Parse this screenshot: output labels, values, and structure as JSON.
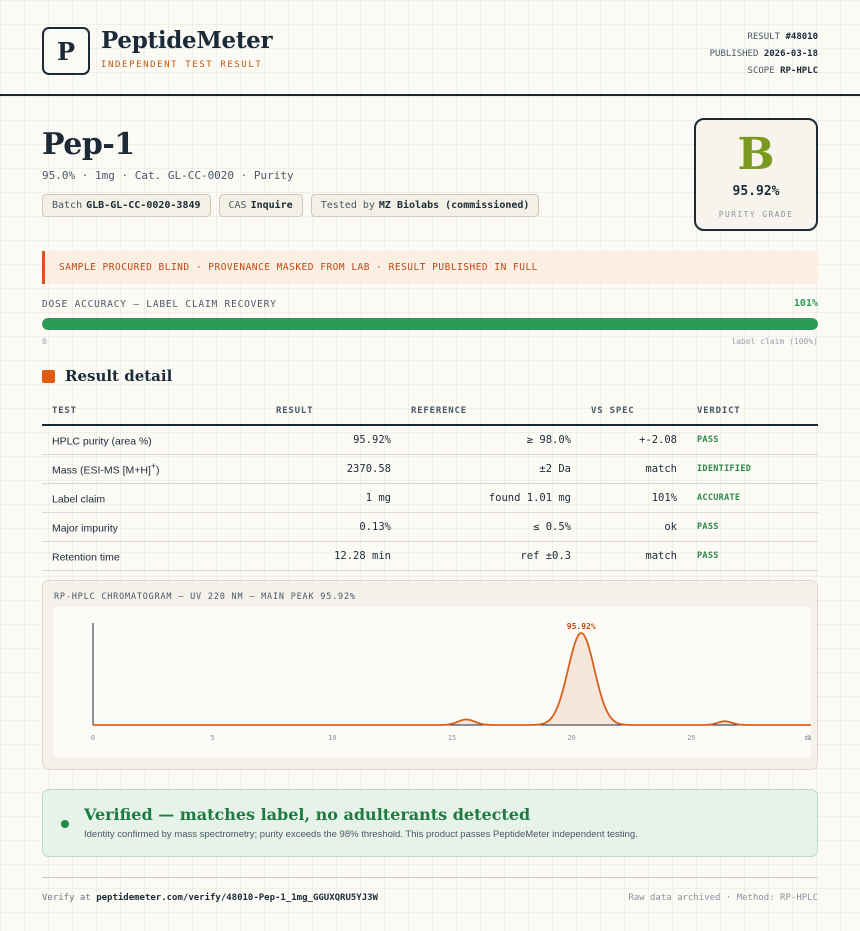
{
  "header": {
    "logo_letter": "P",
    "brand": "PeptideMeter",
    "tagline": "INDEPENDENT TEST RESULT",
    "result_label": "RESULT",
    "result_id": "#48010",
    "published_label": "PUBLISHED",
    "published_date": "2026-03-18",
    "scope_label": "SCOPE",
    "scope_value": "RP-HPLC"
  },
  "product": {
    "name": "Pep-1",
    "specs": "95.0% · 1mg · Cat. GL-CC-0020 · Purity",
    "chips": [
      {
        "label": "Batch",
        "value": "GLB-GL-CC-0020-3849"
      },
      {
        "label": "CAS",
        "value": "Inquire"
      },
      {
        "label": "Tested by",
        "value": "MZ Biolabs (commissioned)"
      }
    ]
  },
  "grade": {
    "letter": "B",
    "value": "95.92%",
    "label": "PURITY GRADE",
    "color": "#7a9a1f"
  },
  "banner": {
    "text": "SAMPLE PROCURED BLIND · PROVENANCE MASKED FROM LAB · RESULT PUBLISHED IN FULL"
  },
  "dose": {
    "label": "DOSE ACCURACY — LABEL CLAIM RECOVERY",
    "value_text": "101%",
    "fill_fraction": 1.0,
    "min_label": "0",
    "max_label": "label claim (100%)",
    "color": "#2e9a57"
  },
  "results": {
    "title": "Result detail",
    "columns": [
      "TEST",
      "RESULT",
      "REFERENCE",
      "VS SPEC",
      "VERDICT"
    ],
    "rows": [
      {
        "test": "HPLC purity (area %)",
        "test_sup": "",
        "test_tail": "",
        "result": "95.92%",
        "reference": "≥ 98.0%",
        "vs_spec": "+-2.08",
        "verdict": "PASS"
      },
      {
        "test": "Mass (ESI-MS [M+H]",
        "test_sup": "+",
        "test_tail": ")",
        "result": "2370.58",
        "reference": "±2 Da",
        "vs_spec": "match",
        "verdict": "IDENTIFIED"
      },
      {
        "test": "Label claim",
        "test_sup": "",
        "test_tail": "",
        "result": "1 mg",
        "reference": "found 1.01 mg",
        "vs_spec": "101%",
        "verdict": "ACCURATE"
      },
      {
        "test": "Major impurity",
        "test_sup": "",
        "test_tail": "",
        "result": "0.13%",
        "reference": "≤ 0.5%",
        "vs_spec": "ok",
        "verdict": "PASS"
      },
      {
        "test": "Retention time",
        "test_sup": "",
        "test_tail": "",
        "result": "12.28 min",
        "reference": "ref ±0.3",
        "vs_spec": "match",
        "verdict": "PASS"
      }
    ]
  },
  "chart_data": {
    "type": "line",
    "title": "RP-HPLC CHROMATOGRAM — UV 220 NM — MAIN PEAK 95.92%",
    "xlabel": "min",
    "ylabel": "",
    "xlim": [
      0,
      30
    ],
    "x_ticks": [
      0,
      5,
      10,
      15,
      20,
      25,
      30
    ],
    "peaks": [
      {
        "center": 15.6,
        "height": 0.06,
        "width": 0.35
      },
      {
        "center": 20.4,
        "height": 1.0,
        "width": 0.55,
        "label": "95.92%"
      },
      {
        "center": 26.4,
        "height": 0.04,
        "width": 0.3
      }
    ],
    "baseline": 0.0,
    "grid": false,
    "color": "#d9601a"
  },
  "verified": {
    "title": "Verified — matches label, no adulterants detected",
    "text": "Identity confirmed by mass spectrometry; purity exceeds the 98% threshold. This product passes PeptideMeter independent testing."
  },
  "footer": {
    "verify_prefix": "Verify at",
    "verify_url": "peptidemeter.com/verify/48010-Pep-1_1mg_GGUXQRU5YJ3W",
    "right_text": "Raw data archived · Method: RP-HPLC"
  }
}
